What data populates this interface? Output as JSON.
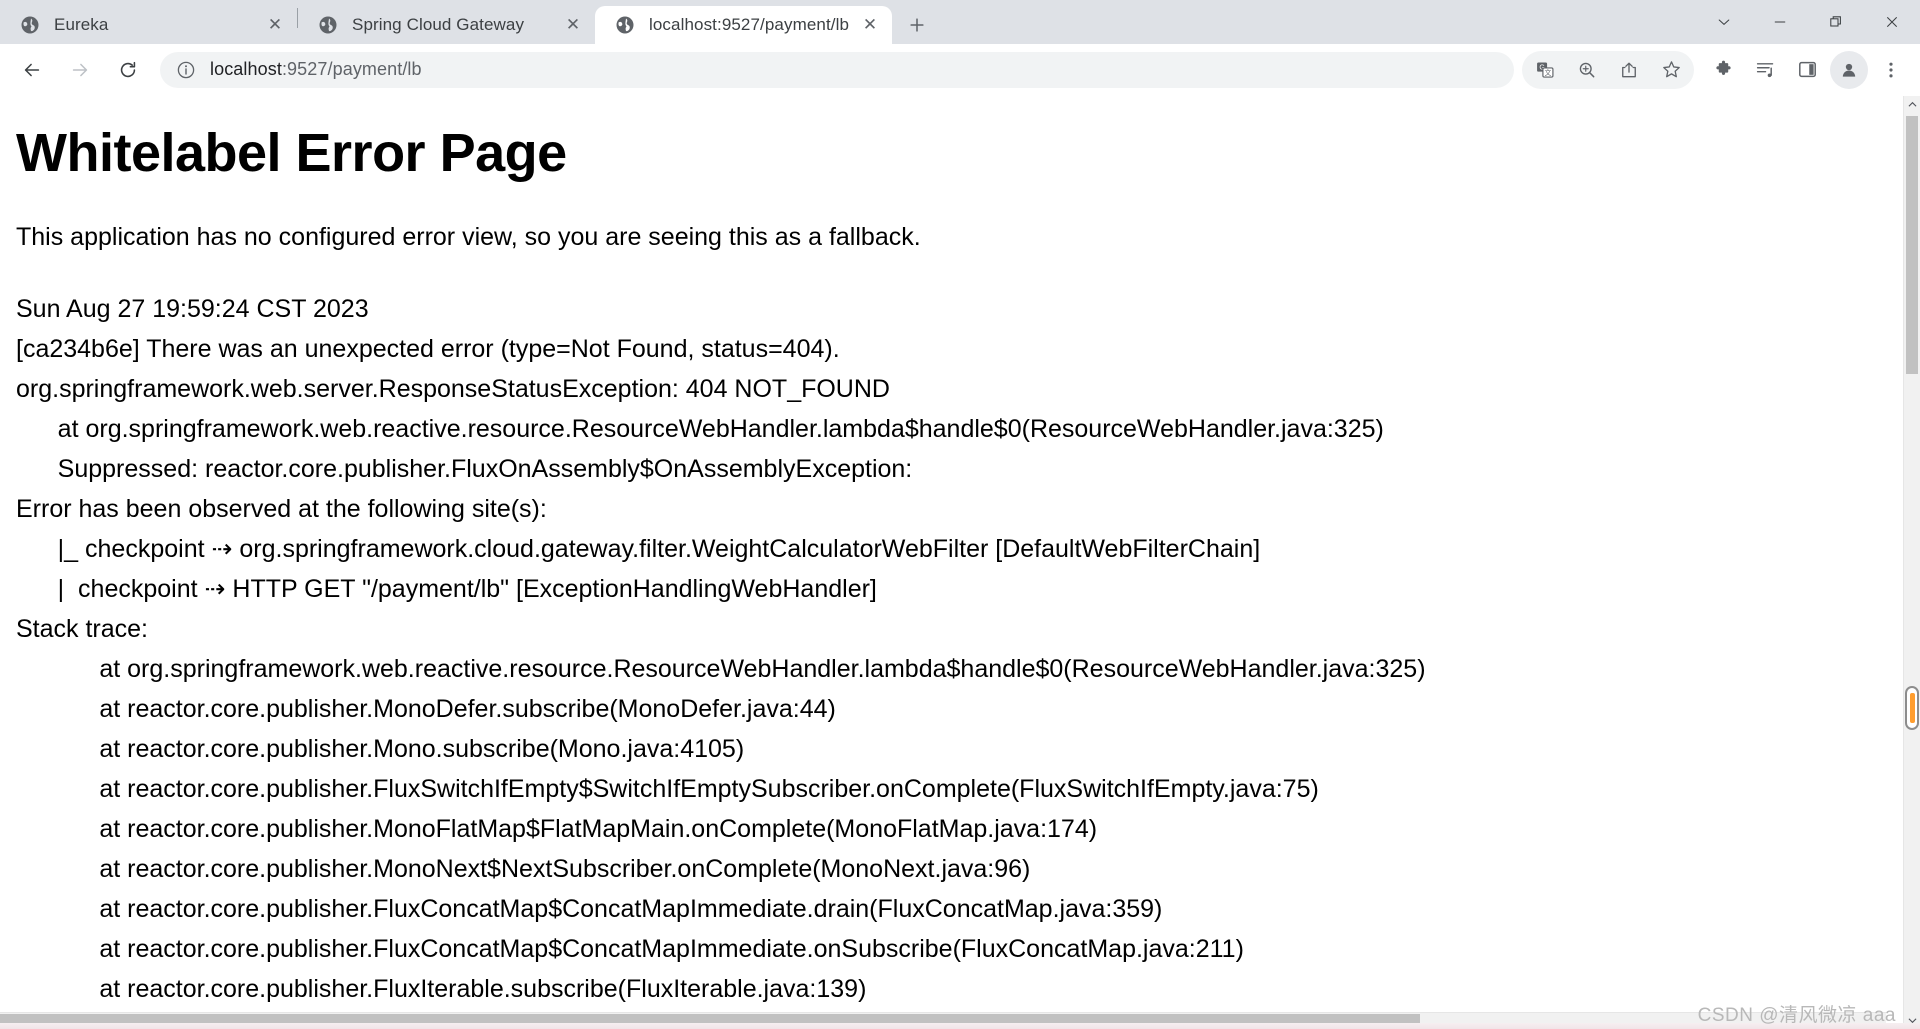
{
  "window": {
    "controls": [
      {
        "name": "tab-search",
        "glyph": "⌄"
      },
      {
        "name": "minimize",
        "glyph": "—"
      },
      {
        "name": "maximize",
        "glyph": "❑"
      },
      {
        "name": "close",
        "glyph": "✕"
      }
    ]
  },
  "tabs": [
    {
      "title": "Eureka",
      "favicon": "globe-icon",
      "active": false,
      "close_glyph": "✕"
    },
    {
      "title": "Spring Cloud Gateway",
      "favicon": "globe-icon",
      "active": false,
      "close_glyph": "✕"
    },
    {
      "title": "localhost:9527/payment/lb",
      "favicon": "globe-icon",
      "active": true,
      "close_glyph": "✕"
    }
  ],
  "newtab": {
    "label": "+",
    "tooltip": "New tab"
  },
  "toolbar": {
    "back_label": "←",
    "forward_label": "→",
    "reload_label": "⟳",
    "url_host": "localhost",
    "url_path": ":9527/payment/lb",
    "url_full": "localhost:9527/payment/lb",
    "site_info_icon": "info-circle-icon",
    "icons": [
      {
        "name": "translate-icon"
      },
      {
        "name": "zoom-icon"
      },
      {
        "name": "share-icon"
      },
      {
        "name": "bookmark-star-icon"
      },
      {
        "name": "extensions-puzzle-icon"
      },
      {
        "name": "media-playlist-icon"
      },
      {
        "name": "side-panel-icon"
      },
      {
        "name": "profile-avatar-icon"
      },
      {
        "name": "three-dot-menu-icon"
      }
    ]
  },
  "page": {
    "title": "Whitelabel Error Page",
    "subtitle": "This application has no configured error view, so you are seeing this as a fallback.",
    "trace_lines": [
      "Sun Aug 27 19:59:24 CST 2023",
      "[ca234b6e] There was an unexpected error (type=Not Found, status=404).",
      "org.springframework.web.server.ResponseStatusException: 404 NOT_FOUND",
      "\tat org.springframework.web.reactive.resource.ResourceWebHandler.lambda$handle$0(ResourceWebHandler.java:325)",
      "\tSuppressed: reactor.core.publisher.FluxOnAssembly$OnAssemblyException: ",
      "Error has been observed at the following site(s):",
      "\t|_ checkpoint ⇢ org.springframework.cloud.gateway.filter.WeightCalculatorWebFilter [DefaultWebFilterChain]",
      "\t|  checkpoint ⇢ HTTP GET \"/payment/lb\" [ExceptionHandlingWebHandler]",
      "Stack trace:",
      "\t\tat org.springframework.web.reactive.resource.ResourceWebHandler.lambda$handle$0(ResourceWebHandler.java:325)",
      "\t\tat reactor.core.publisher.MonoDefer.subscribe(MonoDefer.java:44)",
      "\t\tat reactor.core.publisher.Mono.subscribe(Mono.java:4105)",
      "\t\tat reactor.core.publisher.FluxSwitchIfEmpty$SwitchIfEmptySubscriber.onComplete(FluxSwitchIfEmpty.java:75)",
      "\t\tat reactor.core.publisher.MonoFlatMap$FlatMapMain.onComplete(MonoFlatMap.java:174)",
      "\t\tat reactor.core.publisher.MonoNext$NextSubscriber.onComplete(MonoNext.java:96)",
      "\t\tat reactor.core.publisher.FluxConcatMap$ConcatMapImmediate.drain(FluxConcatMap.java:359)",
      "\t\tat reactor.core.publisher.FluxConcatMap$ConcatMapImmediate.onSubscribe(FluxConcatMap.java:211)",
      "\t\tat reactor.core.publisher.FluxIterable.subscribe(FluxIterable.java:139)"
    ]
  },
  "scrollbars": {
    "vertical_up_glyph": "▲",
    "vertical_down_glyph": "▼",
    "marker_color": "#ff9d2e"
  },
  "watermark": "CSDN @清风微凉 aaa"
}
